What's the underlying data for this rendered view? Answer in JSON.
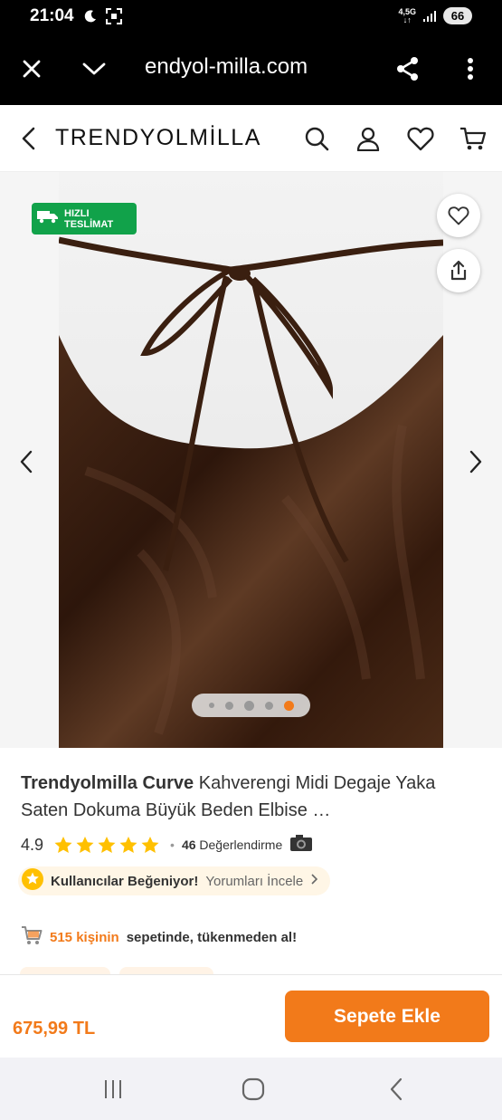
{
  "status_bar": {
    "time": "21:04",
    "network_type_top": "4,5G",
    "network_type_bottom": "↓↑",
    "battery": "66"
  },
  "browser": {
    "url": "endyol-milla.com",
    "icons": [
      "close-icon",
      "chevron-down-icon",
      "share-icon",
      "more-vert-icon"
    ]
  },
  "header": {
    "brand": "TRENDYOLMİLLA",
    "icons": [
      "back-icon",
      "search-icon",
      "user-icon",
      "heart-icon",
      "cart-icon"
    ]
  },
  "gallery": {
    "badge_line1": "HIZLI",
    "badge_line2": "TESLİMAT",
    "image_count": 5,
    "active_index": 4,
    "image_description": "Brown satin dress with tied halter neck"
  },
  "product": {
    "brand": "Trendyolmilla Curve",
    "name": "Kahverengi Midi Degaje Yaka Saten Dokuma Büyük Beden Elbise …",
    "rating": "4.9",
    "stars": 5,
    "review_count": "46",
    "review_label": "Değerlendirme",
    "liked_label": "Kullanıcılar Beğeniyor!",
    "reviews_link": "Yorumları İncele",
    "cart_count_text": "515 kişinin",
    "cart_suffix_text": "sepetinde, tükenmeden al!"
  },
  "bottom": {
    "price": "675,99 TL",
    "add_to_cart": "Sepete Ekle"
  },
  "colors": {
    "accent": "#f27a1a",
    "badge_green": "#11a24a",
    "star": "#ffc000"
  }
}
